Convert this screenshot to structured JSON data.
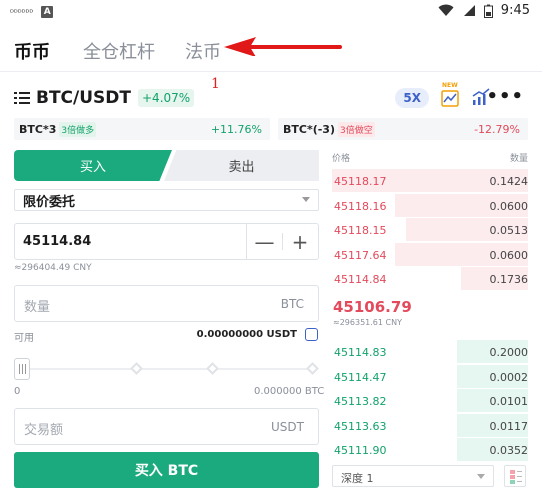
{
  "status": {
    "left_text": "ᴰᴰᴰᴰᴰᴰ",
    "app_badge": "A",
    "time": "9:45"
  },
  "top_tabs": [
    {
      "label": "币币"
    },
    {
      "label": "全仓杠杆"
    },
    {
      "label": "法币"
    }
  ],
  "annotation": {
    "marker": "1"
  },
  "pair": {
    "name": "BTC/USDT",
    "change": "+4.07%",
    "leverage": "5X",
    "new_badge": "NEW"
  },
  "etf": [
    {
      "name": "BTC*3",
      "tag": "3倍做多",
      "value": "+11.76%"
    },
    {
      "name": "BTC*(-3)",
      "tag": "3倍做空",
      "value": "-12.79%"
    }
  ],
  "trade": {
    "buy_tab": "买入",
    "sell_tab": "卖出",
    "order_type": "限价委托",
    "price": "45114.84",
    "minus": "—",
    "plus": "+",
    "price_cny": "≈296404.49 CNY",
    "qty_placeholder": "数量",
    "qty_unit": "BTC",
    "available_label": "可用",
    "available_amount": "0.00000000 USDT",
    "slider_min": "0",
    "slider_max": "0.000000 BTC",
    "amount_placeholder": "交易额",
    "amount_unit": "USDT",
    "submit": "买入 BTC"
  },
  "orderbook": {
    "price_header": "价格",
    "qty_header": "数量",
    "asks": [
      {
        "price": "45118.17",
        "qty": "0.1424",
        "depth": 1.0
      },
      {
        "price": "45118.16",
        "qty": "0.0600",
        "depth": 0.68
      },
      {
        "price": "45118.15",
        "qty": "0.0513",
        "depth": 0.62
      },
      {
        "price": "45117.64",
        "qty": "0.0600",
        "depth": 0.68
      },
      {
        "price": "45114.84",
        "qty": "0.1736",
        "depth": 0.34
      }
    ],
    "mid_price": "45106.79",
    "mid_cny": "≈296351.61 CNY",
    "bids": [
      {
        "price": "45114.83",
        "qty": "0.2000",
        "depth": 0.36
      },
      {
        "price": "45114.47",
        "qty": "0.0002",
        "depth": 0.36
      },
      {
        "price": "45113.82",
        "qty": "0.0101",
        "depth": 0.36
      },
      {
        "price": "45113.63",
        "qty": "0.0117",
        "depth": 0.36
      },
      {
        "price": "45111.90",
        "qty": "0.0352",
        "depth": 0.36
      }
    ],
    "depth_select": "深度 1"
  }
}
